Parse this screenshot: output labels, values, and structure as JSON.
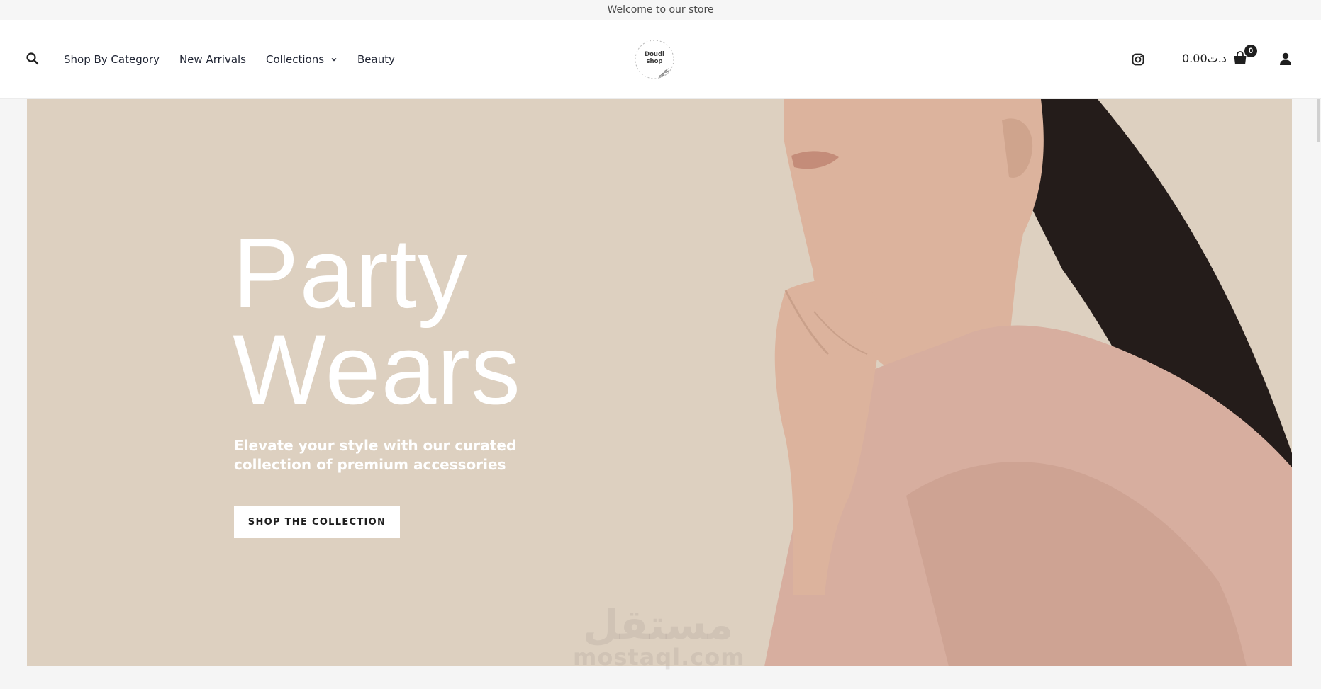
{
  "announcement": {
    "text": "Welcome to our store"
  },
  "header": {
    "nav": [
      {
        "label": "Shop By Category",
        "has_dropdown": false
      },
      {
        "label": "New Arrivals",
        "has_dropdown": false
      },
      {
        "label": "Collections",
        "has_dropdown": true
      },
      {
        "label": "Beauty",
        "has_dropdown": false
      }
    ],
    "logo": {
      "line1": "Doudi",
      "line2": "shop"
    },
    "cart": {
      "amount": "0.00د.ت",
      "count": "0"
    },
    "icons": [
      "search-icon",
      "instagram-icon",
      "shopping-bag-icon",
      "user-icon",
      "chevron-down-icon"
    ]
  },
  "hero": {
    "title_line1": "Party",
    "title_line2": "Wears",
    "subtitle": "Elevate your style with our curated collection of premium accessories",
    "button_label": "SHOP THE COLLECTION",
    "background_color": "#ddd0c0"
  },
  "watermark": {
    "arabic": "مستقل",
    "latin": "mostaql.com"
  },
  "colors": {
    "text_dark": "#1f2433",
    "hero_bg": "#ddd0c0",
    "blouse": "#d7ae9f",
    "skin": "#dcb39d",
    "hair": "#241c1a"
  }
}
